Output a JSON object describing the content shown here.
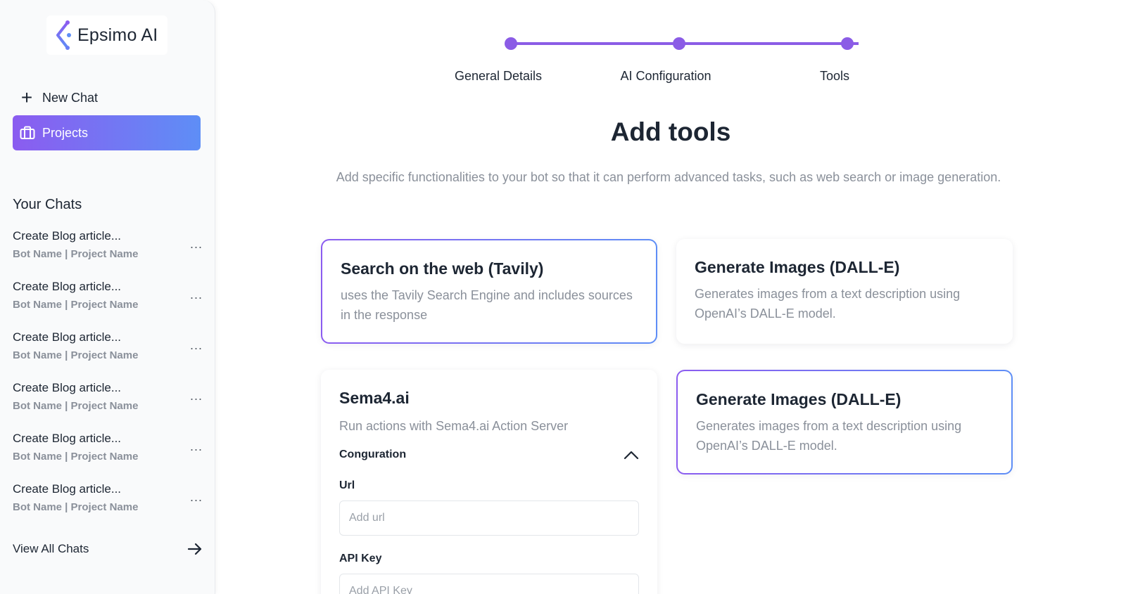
{
  "app": {
    "logo_text": "Epsimo AI",
    "accent_gradient": [
      "#8b5cf0",
      "#5e8ef6"
    ],
    "accent": "#8b5ce6"
  },
  "sidebar": {
    "new_chat_label": "New Chat",
    "new_chat_icon": "plus-icon",
    "projects_label": "Projects",
    "projects_icon": "briefcase-icon",
    "your_chats_heading": "Your Chats",
    "chats": [
      {
        "title": "Create Blog article...",
        "subtitle": "Bot Name | Project Name",
        "more": "..."
      },
      {
        "title": "Create Blog article...",
        "subtitle": "Bot Name | Project Name",
        "more": "..."
      },
      {
        "title": "Create Blog article...",
        "subtitle": "Bot Name | Project Name",
        "more": "..."
      },
      {
        "title": "Create Blog article...",
        "subtitle": "Bot Name | Project Name",
        "more": "..."
      },
      {
        "title": "Create Blog article...",
        "subtitle": "Bot Name | Project Name",
        "more": "..."
      },
      {
        "title": "Create Blog article...",
        "subtitle": "Bot Name | Project Name",
        "more": "..."
      }
    ],
    "view_all_label": "View All Chats",
    "view_all_icon": "arrow-right-icon"
  },
  "stepper": {
    "steps": [
      {
        "label": "General Details"
      },
      {
        "label": "AI Configuration"
      },
      {
        "label": "Tools"
      }
    ],
    "current_step": 3
  },
  "main": {
    "title": "Add tools",
    "description": "Add specific functionalities to your bot so that it can perform advanced tasks, such as web search or image generation.",
    "tools": [
      {
        "title": "Search on the web (Tavily)",
        "description": "uses the Tavily Search Engine and includes sources in the response",
        "selected": true
      },
      {
        "title": "Generate Images (DALL-E)",
        "description": "Generates images from a text description using OpenAI’s DALL-E model.",
        "selected": false
      },
      {
        "title": "Sema4.ai",
        "description": "Run actions with Sema4.ai Action Server",
        "selected": false,
        "config_label": "Conguration",
        "config_icon": "chevron-up-icon",
        "fields": [
          {
            "label": "Url",
            "placeholder": "Add url",
            "value": ""
          },
          {
            "label": "API Key",
            "placeholder": "Add API Key",
            "value": ""
          }
        ]
      },
      {
        "title": "Generate Images (DALL-E)",
        "description": "Generates images from a text description using OpenAI’s DALL-E model.",
        "selected": true
      }
    ]
  }
}
